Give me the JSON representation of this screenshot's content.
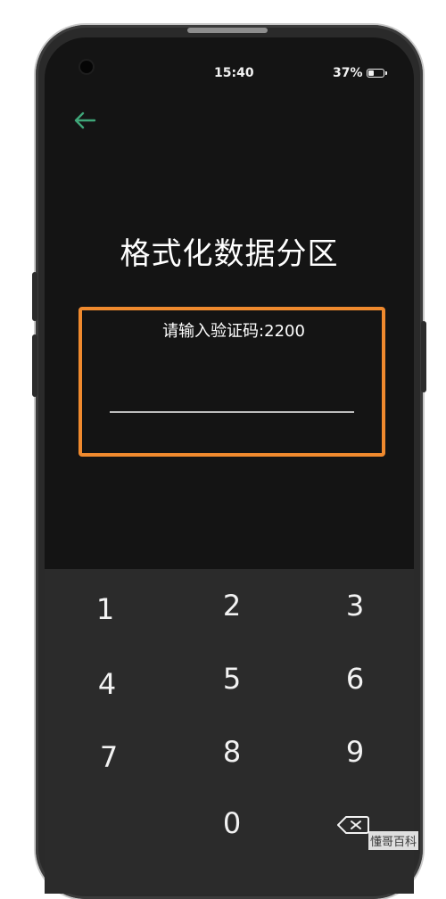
{
  "status_bar": {
    "time": "15:40",
    "battery": "37%"
  },
  "page": {
    "title": "格式化数据分区",
    "prompt": "请输入验证码:2200"
  },
  "input": {
    "value": "",
    "placeholder": ""
  },
  "keypad": {
    "keys": [
      "1",
      "2",
      "3",
      "4",
      "5",
      "6",
      "7",
      "8",
      "9",
      "0"
    ]
  },
  "watermark": "懂哥百科",
  "colors": {
    "accent_back": "#3fa679",
    "highlight": "#f08a2e",
    "keypad_bg": "#2b2b2b"
  }
}
